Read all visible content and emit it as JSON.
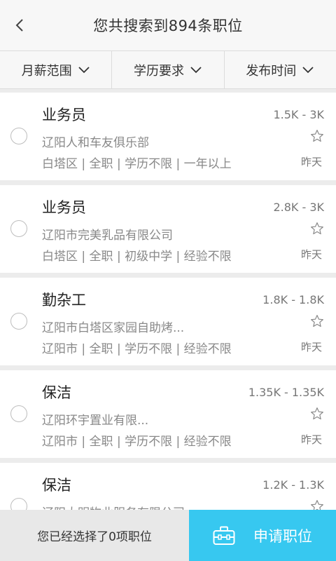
{
  "header": {
    "title": "您共搜索到894条职位"
  },
  "filters": [
    {
      "label": "月薪范围"
    },
    {
      "label": "学历要求"
    },
    {
      "label": "发布时间"
    }
  ],
  "jobs": [
    {
      "title": "业务员",
      "salary": "1.5K - 3K",
      "company": "辽阳人和车友俱乐部",
      "tags": "白塔区 | 全职 | 学历不限 | 一年以上",
      "time": "昨天"
    },
    {
      "title": "业务员",
      "salary": "2.8K - 3K",
      "company": "辽阳市完美乳品有限公司",
      "tags": "白塔区 | 全职 | 初级中学 | 经验不限",
      "time": "昨天"
    },
    {
      "title": "勤杂工",
      "salary": "1.8K - 1.8K",
      "company": "辽阳市白塔区家园自助烤...",
      "tags": "辽阳市 | 全职 | 学历不限 | 经验不限",
      "time": "昨天"
    },
    {
      "title": "保洁",
      "salary": "1.35K - 1.35K",
      "company": "辽阳环宇置业有限...",
      "tags": "辽阳市 | 全职 | 学历不限 | 经验不限",
      "time": "昨天"
    },
    {
      "title": "保洁",
      "salary": "1.2K - 1.3K",
      "company": "辽阳大明物业服务有限公司",
      "tags": "",
      "time": ""
    }
  ],
  "footer": {
    "selected_text": "您已经选择了0项职位",
    "apply_label": "申请职位"
  },
  "colors": {
    "accent": "#37c8f0"
  }
}
